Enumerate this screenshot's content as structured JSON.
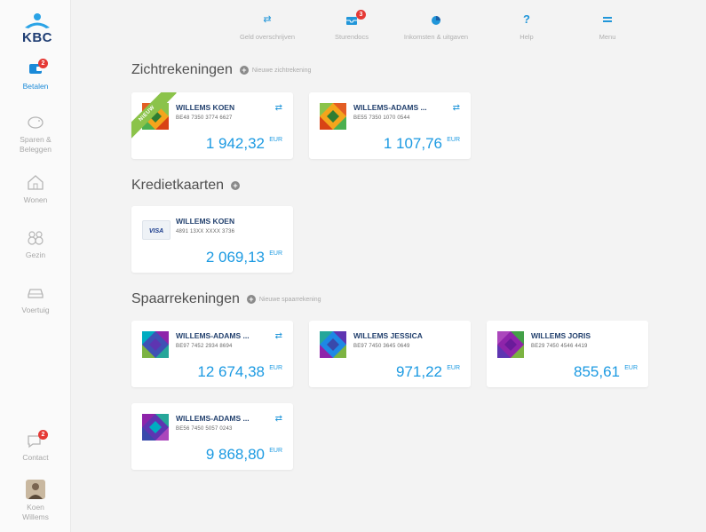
{
  "brand": {
    "name": "KBC"
  },
  "sidebar": {
    "items": [
      {
        "label": "Betalen",
        "badge": "2"
      },
      {
        "label": "Sparen & Beleggen"
      },
      {
        "label": "Wonen"
      },
      {
        "label": "Gezin"
      },
      {
        "label": "Voertuig"
      },
      {
        "label": "Contact",
        "badge": "2"
      },
      {
        "label": "Koen Willems"
      }
    ]
  },
  "toolbar": {
    "items": [
      {
        "label": "Geld overschrijven"
      },
      {
        "label": "Sturendocs",
        "badge": "3"
      },
      {
        "label": "Inkomsten & uitgaven"
      },
      {
        "label": "Help"
      },
      {
        "label": "Menu"
      }
    ]
  },
  "sections": {
    "zicht": {
      "title": "Zichtrekeningen",
      "add_label": "Nieuwe zichtrekening"
    },
    "krediet": {
      "title": "Kredietkaarten"
    },
    "spaar": {
      "title": "Spaarrekeningen",
      "add_label": "Nieuwe spaarrekening"
    }
  },
  "accounts": {
    "zicht": [
      {
        "name": "WILLEMS KOEN",
        "iban": "BE48 7350 3774 6627",
        "amount": "1 942,32",
        "currency": "EUR",
        "ribbon": "NIEUW"
      },
      {
        "name": "WILLEMS-ADAMS ...",
        "iban": "BE55 7350 1070 0544",
        "amount": "1 107,76",
        "currency": "EUR"
      }
    ],
    "krediet": [
      {
        "name": "WILLEMS KOEN",
        "iban": "4891 13XX XXXX 3736",
        "amount": "2 069,13",
        "currency": "EUR",
        "card_brand": "VISA"
      }
    ],
    "spaar": [
      {
        "name": "WILLEMS-ADAMS ...",
        "iban": "BE97 7452 2934 8694",
        "amount": "12 674,38",
        "currency": "EUR"
      },
      {
        "name": "WILLEMS JESSICA",
        "iban": "BE97 7450 3645 0649",
        "amount": "971,22",
        "currency": "EUR"
      },
      {
        "name": "WILLEMS JORIS",
        "iban": "BE29 7450 4546 4419",
        "amount": "855,61",
        "currency": "EUR"
      },
      {
        "name": "WILLEMS-ADAMS ...",
        "iban": "BE56 7450 5057 0243",
        "amount": "9 868,80",
        "currency": "EUR"
      }
    ]
  },
  "icons": {
    "transfer": "⇄",
    "add": "+"
  },
  "colors": {
    "accent": "#1c9ae2",
    "brand_blue": "#1f3d73",
    "badge": "#e53935",
    "ribbon": "#8bc34a"
  }
}
